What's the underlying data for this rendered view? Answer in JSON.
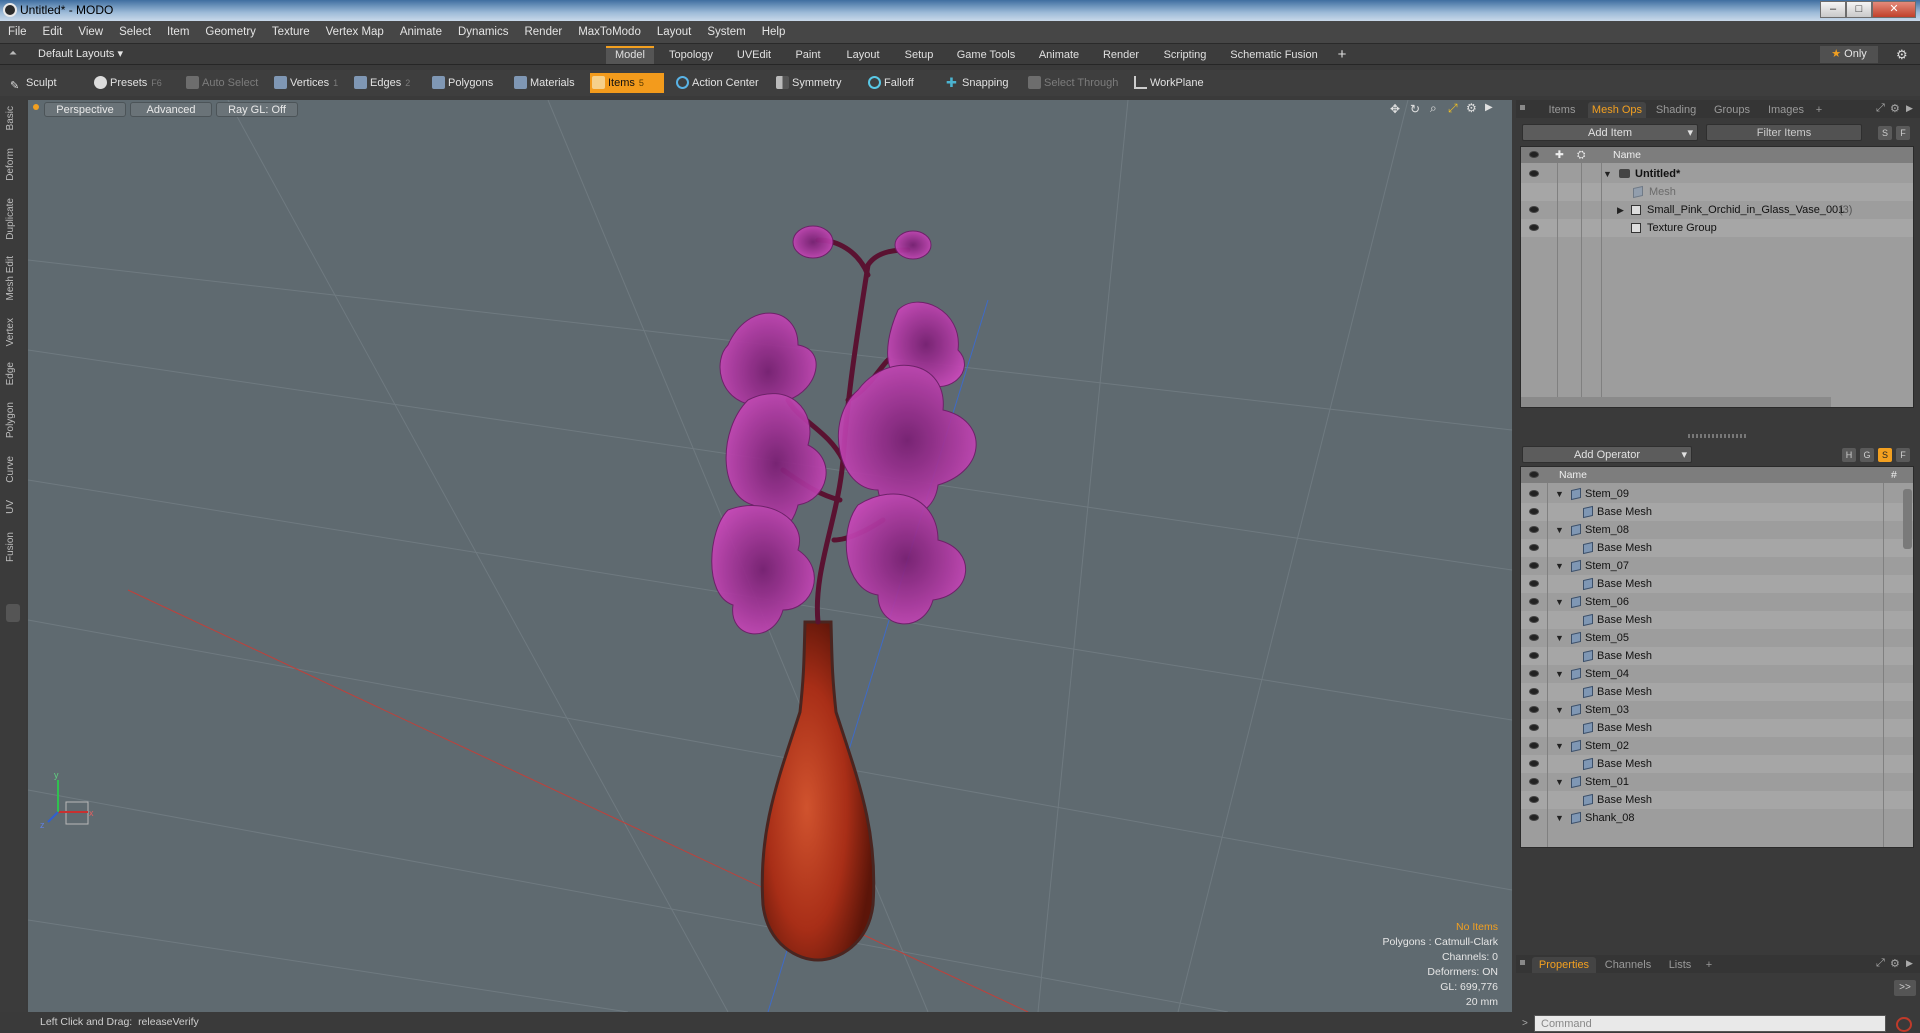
{
  "window": {
    "title": "Untitled* - MODO",
    "min": "–",
    "max": "□",
    "close": "✕"
  },
  "menu": [
    "File",
    "Edit",
    "View",
    "Select",
    "Item",
    "Geometry",
    "Texture",
    "Vertex Map",
    "Animate",
    "Dynamics",
    "Render",
    "MaxToModo",
    "Layout",
    "System",
    "Help"
  ],
  "layouts": {
    "current": "Default Layouts",
    "tabs": [
      "Model",
      "Topology",
      "UVEdit",
      "Paint",
      "Layout",
      "Setup",
      "Game Tools",
      "Animate",
      "Render",
      "Scripting",
      "Schematic Fusion"
    ],
    "active": "Model",
    "add": "+",
    "only_label": "Only"
  },
  "toolbar": {
    "sculpt": "Sculpt",
    "presets": "Presets",
    "presets_key": "F6",
    "auto_select": "Auto Select",
    "vertices": "Vertices",
    "vertices_key": "1",
    "edges": "Edges",
    "edges_key": "2",
    "polygons": "Polygons",
    "materials": "Materials",
    "items": "Items",
    "items_key": "5",
    "action_center": "Action Center",
    "symmetry": "Symmetry",
    "falloff": "Falloff",
    "snapping": "Snapping",
    "select_through": "Select Through",
    "workplane": "WorkPlane"
  },
  "side_tabs": [
    "Basic",
    "Deform",
    "Duplicate",
    "Mesh Edit",
    "Vertex",
    "Edge",
    "Polygon",
    "Curve",
    "UV",
    "Fusion"
  ],
  "viewport": {
    "view": "Perspective",
    "mode": "Advanced",
    "raygl": "Ray GL: Off",
    "hud": {
      "items": "No Items",
      "polygons": "Polygons : Catmull-Clark",
      "channels": "Channels: 0",
      "deformers": "Deformers: ON",
      "gl": "GL: 699,776",
      "scale": "20 mm"
    },
    "axis": {
      "x": "x",
      "y": "y",
      "z": "z"
    }
  },
  "status": {
    "label": "Left Click and Drag:",
    "value": "releaseVerify"
  },
  "items_panel": {
    "tabs": [
      "Items",
      "Mesh Ops",
      "Shading",
      "Groups",
      "Images"
    ],
    "active": "Mesh Ops",
    "add_tab": "+",
    "add_item": "Add Item",
    "filter": "Filter Items",
    "s": "S",
    "f": "F",
    "col_name": "Name",
    "tree": [
      {
        "label": "Untitled*",
        "depth": 0
      },
      {
        "label": "Mesh",
        "depth": 1
      },
      {
        "label": "Small_Pink_Orchid_in_Glass_Vase_001",
        "count": "(3)",
        "depth": 1
      },
      {
        "label": "Texture Group",
        "depth": 1
      }
    ]
  },
  "meshops_panel": {
    "add_operator": "Add Operator",
    "h": "H",
    "g": "G",
    "s": "S",
    "f": "F",
    "col_name": "Name",
    "col_hash": "#",
    "rows": [
      "Stem_09",
      "Base Mesh",
      "Stem_08",
      "Base Mesh",
      "Stem_07",
      "Base Mesh",
      "Stem_06",
      "Base Mesh",
      "Stem_05",
      "Base Mesh",
      "Stem_04",
      "Base Mesh",
      "Stem_03",
      "Base Mesh",
      "Stem_02",
      "Base Mesh",
      "Stem_01",
      "Base Mesh",
      "Shank_08"
    ]
  },
  "props_panel": {
    "tabs": [
      "Properties",
      "Channels",
      "Lists"
    ],
    "active": "Properties",
    "add_tab": "+",
    "expand": ">>"
  },
  "command": {
    "placeholder": "Command"
  },
  "colors": {
    "accent": "#f3a020",
    "viewport": "#5f6a70",
    "petal": "#c23fb0",
    "vase": "#b5351a"
  }
}
